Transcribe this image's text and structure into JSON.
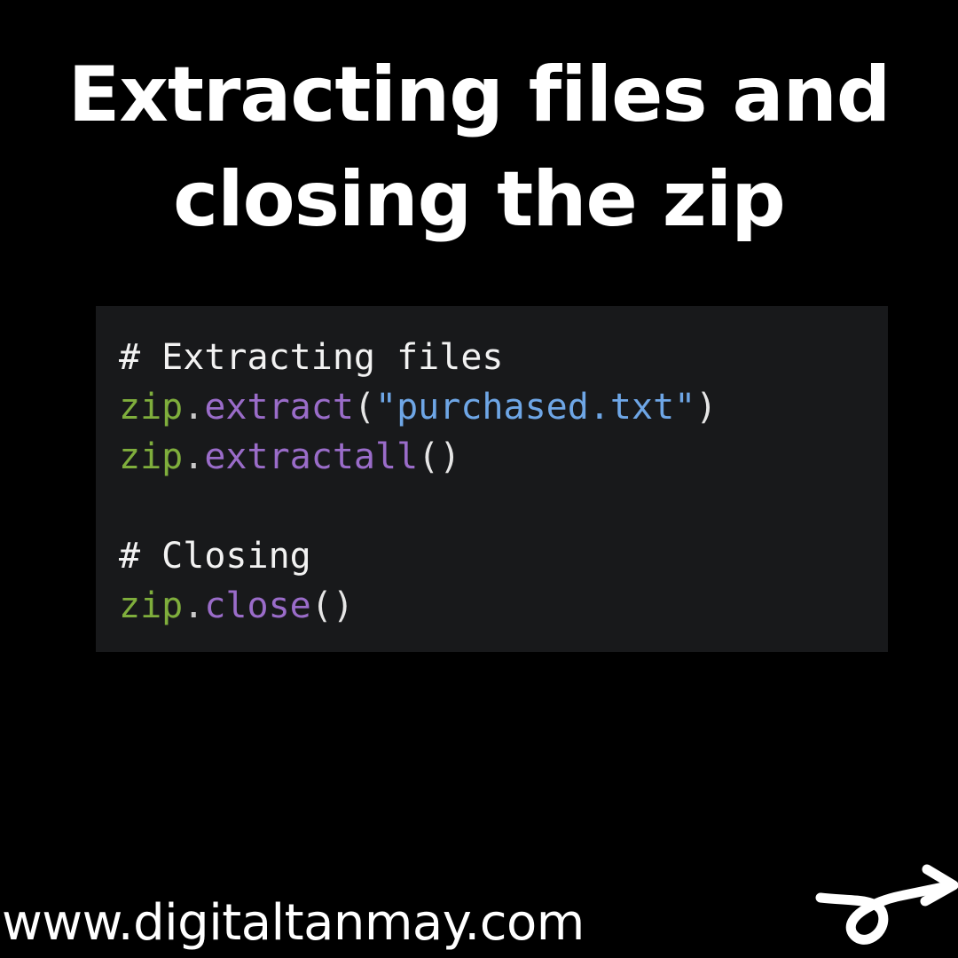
{
  "title": {
    "line1": "Extracting files and",
    "line2": "closing the zip"
  },
  "code": {
    "lines": [
      [
        {
          "t": "comment",
          "v": "# Extracting files"
        }
      ],
      [
        {
          "t": "obj",
          "v": "zip"
        },
        {
          "t": "dot",
          "v": "."
        },
        {
          "t": "method",
          "v": "extract"
        },
        {
          "t": "paren",
          "v": "("
        },
        {
          "t": "string",
          "v": "\"purchased.txt\""
        },
        {
          "t": "paren",
          "v": ")"
        }
      ],
      [
        {
          "t": "obj",
          "v": "zip"
        },
        {
          "t": "dot",
          "v": "."
        },
        {
          "t": "method",
          "v": "extractall"
        },
        {
          "t": "paren",
          "v": "()"
        }
      ],
      [],
      [
        {
          "t": "comment",
          "v": "# Closing"
        }
      ],
      [
        {
          "t": "obj",
          "v": "zip"
        },
        {
          "t": "dot",
          "v": "."
        },
        {
          "t": "method",
          "v": "close"
        },
        {
          "t": "paren",
          "v": "()"
        }
      ]
    ]
  },
  "footer": {
    "url": "www.digitaltanmay.com"
  },
  "colors": {
    "background": "#000000",
    "code_background": "#18191b",
    "comment": "#f2f2f2",
    "object": "#7fae3c",
    "method": "#9a6cc9",
    "string": "#6ea6e6"
  },
  "icons": {
    "brand_logo": "loop-arrow-logo-icon"
  }
}
